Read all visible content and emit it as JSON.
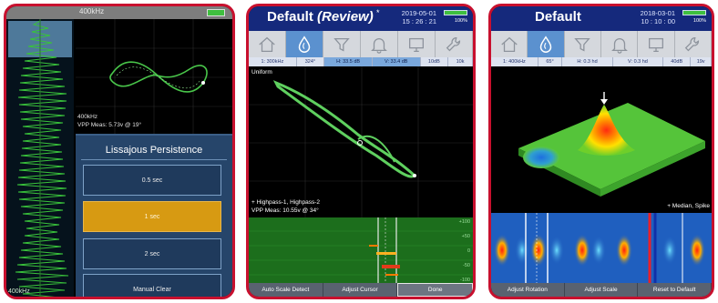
{
  "device1": {
    "frequency": "400kHz",
    "strip_label": "400kHz",
    "lissajous_info": [
      "400kHz",
      "VPP Meas: 5.73v @ 19°"
    ],
    "menu": {
      "title": "Lissajous Persistence",
      "options": [
        {
          "label": "0.5 sec",
          "selected": false
        },
        {
          "label": "1 sec",
          "selected": true
        },
        {
          "label": "2 sec",
          "selected": false
        },
        {
          "label": "Manual Clear",
          "selected": false
        }
      ]
    }
  },
  "device2": {
    "title": "Default",
    "title_suffix": "(Review)",
    "title_mark": "*",
    "date": "2019-05-01",
    "time": "15 : 26 : 21",
    "battery": "100%",
    "toolbar": [
      "home-icon",
      "probe-icon",
      "filter-icon",
      "alarm-bell-icon",
      "display-icon",
      "wrench-icon"
    ],
    "status": [
      "1: 300kHz",
      "324°",
      "H: 33.5 dB",
      "V: 33.4 dB",
      "10dB",
      "10k"
    ],
    "plot_label": "Uniform",
    "plot_info": [
      "+ Highpass-1, Highpass-2",
      "VPP Meas: 10.55v @ 34°"
    ],
    "strip_y": [
      "+100",
      "+50",
      "0",
      "-50",
      "-100"
    ],
    "bottom_buttons": [
      "Auto Scale Detect",
      "Adjust Cursor",
      "Done"
    ]
  },
  "device3": {
    "title": "Default",
    "date": "2018-03-01",
    "time": "10 : 10 : 00",
    "battery": "100%",
    "toolbar": [
      "home-icon",
      "probe-icon",
      "filter-icon",
      "alarm-bell-icon",
      "display-icon",
      "wrench-icon"
    ],
    "status": [
      "1: 400kHz",
      "65°",
      "H: 0.3 hd",
      "V: 0.3 hd",
      "40dB",
      "19v"
    ],
    "plot_note": "+ Median, Spike",
    "bottom_buttons": [
      "Adjust Rotation",
      "Adjust Scale",
      "Reset to Default"
    ]
  },
  "colors": {
    "frame": "#c8102e",
    "header": "#15297c",
    "toolbar_active": "#5b91cf",
    "menu_selected": "#d79a12",
    "signal_green": "#3fbf3f"
  }
}
